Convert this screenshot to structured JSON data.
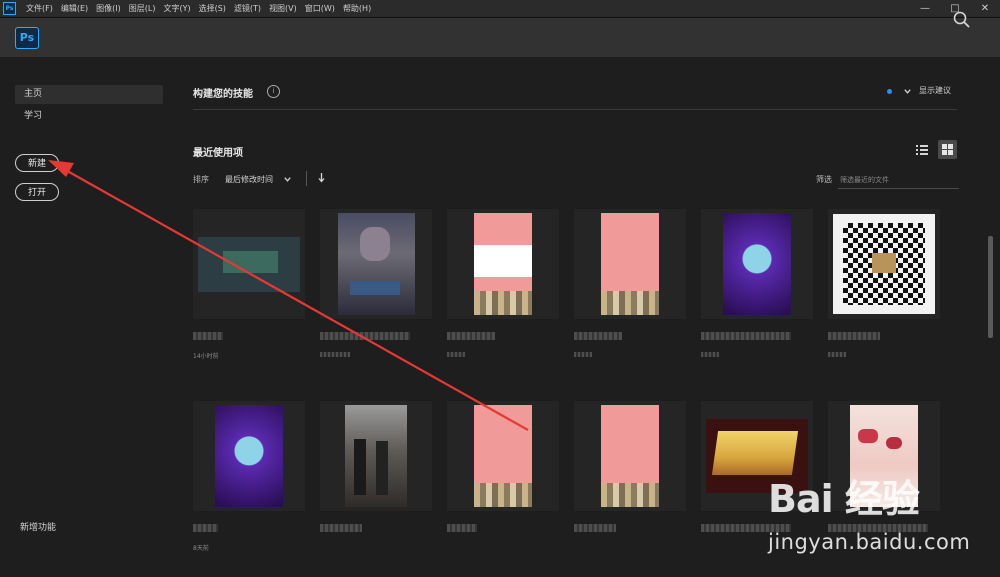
{
  "menubar": {
    "app_badge": "Ps",
    "items": [
      "文件(F)",
      "编辑(E)",
      "图像(I)",
      "图层(L)",
      "文字(Y)",
      "选择(S)",
      "滤镜(T)",
      "视图(V)",
      "窗口(W)",
      "帮助(H)"
    ]
  },
  "window_controls": {
    "minimize": "—",
    "maximize": "□",
    "close": "✕"
  },
  "topbar": {
    "logo": "Ps",
    "icon_search": "search-icon"
  },
  "sidebar": {
    "home": "主页",
    "learn": "学习",
    "new_button": "新建",
    "open_button": "打开",
    "whats_new": "新增功能"
  },
  "skills": {
    "title": "构建您的技能",
    "show_suggestions": "显示建议",
    "info_icon": "i"
  },
  "recent": {
    "title": "最近使用项",
    "sort_label": "排序",
    "sort_value": "最后修改时间",
    "filter_label": "筛选",
    "filter_placeholder": "筛选最近的文件"
  },
  "files": [
    {
      "meta": "14小时前"
    },
    {
      "meta": ""
    },
    {
      "meta": ""
    },
    {
      "meta": ""
    },
    {
      "meta": ""
    },
    {
      "meta": ""
    },
    {
      "meta": "8天前"
    },
    {
      "meta": ""
    },
    {
      "meta": ""
    },
    {
      "meta": ""
    },
    {
      "meta": ""
    },
    {
      "meta": ""
    }
  ],
  "watermark": {
    "brand": "Bai 经验",
    "site": "jingyan.baidu.com"
  },
  "colors": {
    "accent": "#31a8ff",
    "annotation_arrow": "#e53935",
    "dot": "#2f8cf0"
  }
}
